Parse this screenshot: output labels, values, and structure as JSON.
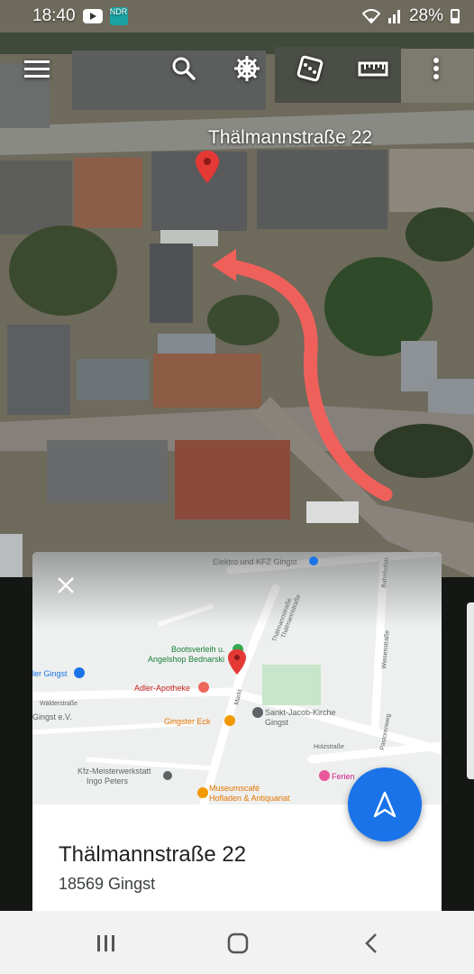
{
  "status": {
    "time": "18:40",
    "battery": "28%",
    "app_badge": "NDR"
  },
  "toolbar": {
    "menu_icon": "menu-icon",
    "search_icon": "search-icon",
    "voyager_icon": "ship-wheel-icon",
    "feeling_lucky_icon": "dice-icon",
    "measure_icon": "ruler-icon",
    "more_icon": "more-vert-icon"
  },
  "map": {
    "place_label": "Thälmannstraße 22",
    "route_color": "#f0605a"
  },
  "card": {
    "title": "Thälmannstraße 22",
    "subtitle": "18569 Gingst",
    "minimap_labels": {
      "elektro": "Elektro und KFZ Gingst",
      "boots1": "Bootsverleih u.",
      "boots2": "Angelshop Bednarski",
      "adler": "Adler-Apotheke",
      "gingster_eck": "Gingster Eck",
      "kirche1": "Sankt-Jacob-Kirche",
      "kirche2": "Gingst",
      "kfz1": "Kfz-Meisterwerkstatt",
      "kfz2": "Ingo Peters",
      "museum1": "Museumscafé",
      "museum2": "Hofladen & Antiquariat",
      "ferien": "Ferien",
      "ler_gingst": "ler Gingst",
      "gingst_ev": "Gingst e.V.",
      "walderstrasse": "Wälderstraße",
      "thaelmann1": "Thälmannstraße",
      "thaelmann2": "Thälmannstraße",
      "markt": "Markt",
      "holzstrasse": "Holzstraße",
      "bahnhof": "Bahnhofstr.",
      "weg1": "Wiesenstraße",
      "weg2": "Pastorenweg"
    }
  },
  "colors": {
    "accent": "#1a73e8",
    "pin": "#e53935"
  }
}
